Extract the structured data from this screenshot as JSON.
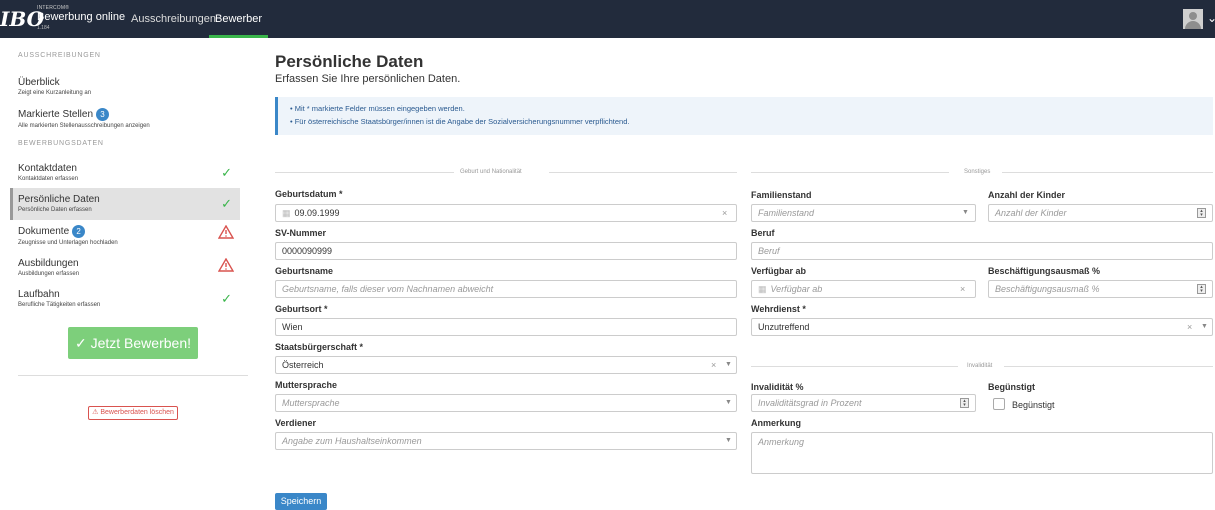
{
  "header": {
    "logo": "IBO",
    "brand_small": "INTERCOM®",
    "brand_title": "Bewerbung online",
    "version": "1.184",
    "nav": [
      "Ausschreibungen",
      "Bewerber"
    ]
  },
  "sidebar": {
    "section1": "AUSSCHREIBUNGEN",
    "section2": "BEWERBUNGSDATEN",
    "items": [
      {
        "title": "Überblick",
        "sub": "Zeigt eine Kurzanleitung an"
      },
      {
        "title": "Markierte Stellen",
        "sub": "Alle markierten Stellenausschreibungen anzeigen",
        "badge": "3"
      },
      {
        "title": "Kontaktdaten",
        "sub": "Kontaktdaten erfassen",
        "status": "ok"
      },
      {
        "title": "Persönliche Daten",
        "sub": "Persönliche Daten erfassen",
        "status": "ok"
      },
      {
        "title": "Dokumente",
        "sub": "Zeugnisse und Unterlagen hochladen",
        "badge": "2",
        "status": "warning"
      },
      {
        "title": "Ausbildungen",
        "sub": "Ausbildungen erfassen",
        "status": "warning"
      },
      {
        "title": "Laufbahn",
        "sub": "Berufliche Tätigkeiten erfassen",
        "status": "ok"
      }
    ],
    "apply_button": "✓ Jetzt Bewerben!",
    "delete_button": "Bewerberdaten löschen"
  },
  "main": {
    "title": "Persönliche Daten",
    "subtitle": "Erfassen Sie Ihre persönlichen Daten.",
    "info": [
      "Mit * markierte Felder müssen eingegeben werden.",
      "Für österreichische Staatsbürger/innen ist die Angabe der Sozialversicherungsnummer verpflichtend."
    ],
    "section_left": "Geburt und Nationalität",
    "section_right": "Sonstiges",
    "section_invalid": "Invalidität",
    "left": {
      "geburtsdatum": {
        "label": "Geburtsdatum *",
        "value": "09.09.1999"
      },
      "sv": {
        "label": "SV-Nummer",
        "value": "0000090999"
      },
      "geburtsname": {
        "label": "Geburtsname",
        "placeholder": "Geburtsname, falls dieser vom Nachnamen abweicht"
      },
      "geburtsort": {
        "label": "Geburtsort *",
        "value": "Wien"
      },
      "staatsbuergerschaft": {
        "label": "Staatsbürgerschaft *",
        "value": "Österreich"
      },
      "muttersprache": {
        "label": "Muttersprache",
        "placeholder": "Muttersprache"
      },
      "verdiener": {
        "label": "Verdiener",
        "placeholder": "Angabe zum Haushaltseinkommen"
      }
    },
    "right": {
      "familienstand": {
        "label": "Familienstand",
        "placeholder": "Familienstand"
      },
      "kinder": {
        "label": "Anzahl der Kinder",
        "placeholder": "Anzahl der Kinder"
      },
      "beruf": {
        "label": "Beruf",
        "placeholder": "Beruf"
      },
      "verfuegbar": {
        "label": "Verfügbar ab",
        "placeholder": "Verfügbar ab"
      },
      "ausmass": {
        "label": "Beschäftigungsausmaß %",
        "placeholder": "Beschäftigungsausmaß %"
      },
      "wehrdienst": {
        "label": "Wehrdienst *",
        "value": "Unzutreffend"
      },
      "invaliditaet": {
        "label": "Invalidität %",
        "placeholder": "Invaliditätsgrad in Prozent"
      },
      "beguenstigt": {
        "label": "Begünstigt",
        "checkbox_label": "Begünstigt"
      },
      "anmerkung": {
        "label": "Anmerkung",
        "placeholder": "Anmerkung"
      }
    },
    "save_button": "Speichern"
  },
  "colors": {
    "topbar": "#222b3c",
    "accent": "#39b54a",
    "primary": "#3a87c8",
    "danger": "#d9534f"
  }
}
